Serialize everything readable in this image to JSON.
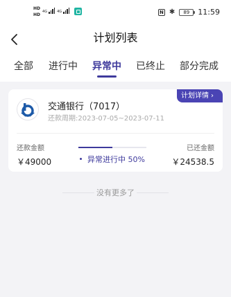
{
  "status_bar": {
    "hd1": "HD",
    "hd2": "HD",
    "net1": "4G",
    "net2": "4G",
    "battery": "89",
    "time": "11:59",
    "icons": [
      "hd-icon",
      "signal-icon",
      "app-notification-icon",
      "nfc-icon",
      "bluetooth-icon",
      "battery-icon"
    ]
  },
  "header": {
    "title": "计划列表",
    "back_icon": "chevron-left-icon"
  },
  "tabs": [
    {
      "label": "全部",
      "active": false
    },
    {
      "label": "进行中",
      "active": false
    },
    {
      "label": "异常中",
      "active": true
    },
    {
      "label": "已终止",
      "active": false
    },
    {
      "label": "部分完成",
      "active": false
    }
  ],
  "plan": {
    "detail_label": "计划详情",
    "bank_name": "交通银行（7017）",
    "period_label": "还款周期:",
    "period": "2023-07-05~2023-07-11",
    "repay_label": "还款金额",
    "repay_value": "￥49000",
    "paid_label": "已还金额",
    "paid_value": "￥24538.5",
    "status_text": "异常进行中 50%",
    "progress": 0.5
  },
  "footer": {
    "no_more": "没有更多了"
  },
  "colors": {
    "accent": "#3e3a9c",
    "detail_button": "#4a44b4",
    "background": "#f3f3f6",
    "bank_logo": "#1d5aa8"
  }
}
